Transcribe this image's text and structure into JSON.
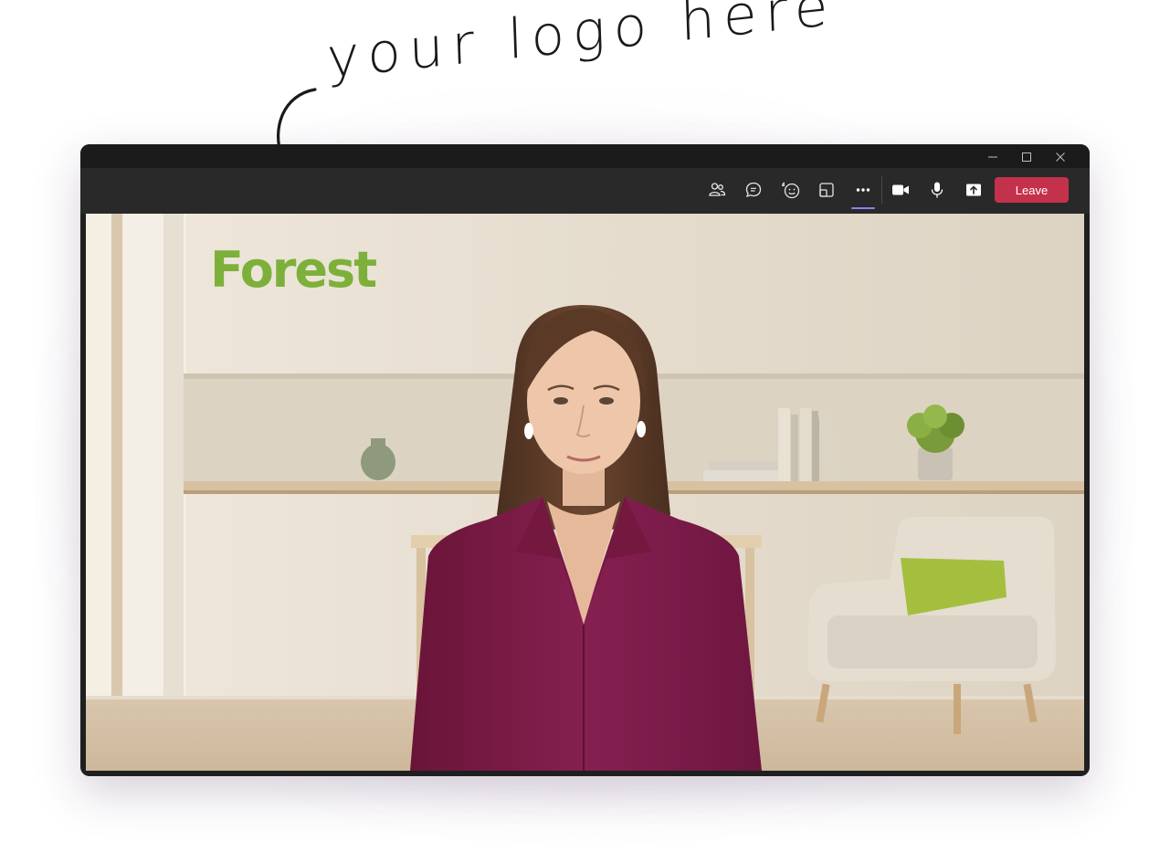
{
  "annotation": {
    "text": "your logo here"
  },
  "window_controls": [
    {
      "name": "minimize-icon"
    },
    {
      "name": "maximize-icon"
    },
    {
      "name": "close-icon"
    }
  ],
  "toolbar": {
    "buttons": [
      {
        "name": "people-icon"
      },
      {
        "name": "chat-icon"
      },
      {
        "name": "react-icon"
      },
      {
        "name": "rooms-icon"
      },
      {
        "name": "more-icon",
        "active": true
      },
      {
        "name": "camera-icon"
      },
      {
        "name": "mic-icon"
      },
      {
        "name": "share-icon"
      }
    ],
    "leave_label": "Leave"
  },
  "video": {
    "background_logo": "Forest"
  },
  "colors": {
    "leave": "#c4314b",
    "active_indicator": "#7f85f5",
    "logo": "#7db03a",
    "blazer": "#7a1a45"
  }
}
